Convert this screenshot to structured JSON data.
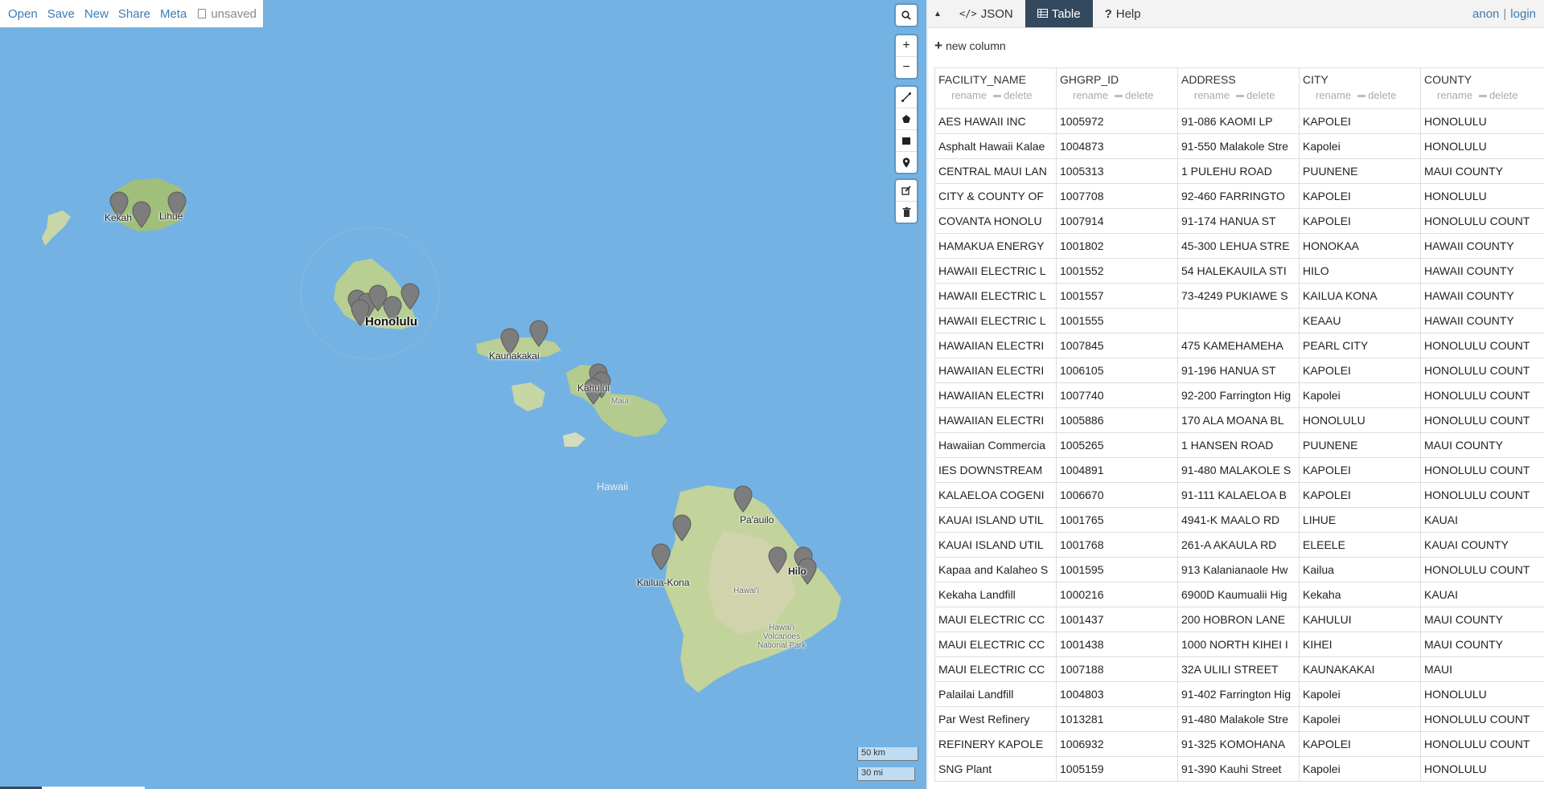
{
  "nav": {
    "open": "Open",
    "save": "Save",
    "new": "New",
    "share": "Share",
    "meta": "Meta",
    "unsaved": "unsaved"
  },
  "map": {
    "labels": {
      "kekaha": "Kekah",
      "lihue": "Lihue",
      "honolulu": "Honolulu",
      "kaunakakai": "Kaunakakai",
      "kahului": "Kahului",
      "maui": "Maui",
      "hawaii_sea": "Hawaii",
      "paauilo": "Pa'auilo",
      "kailua_kona": "Kailua-Kona",
      "hawaii_island": "Hawai'i",
      "hilo": "Hilo",
      "volcanoes": "Hawai'i Volcanoes National Park"
    },
    "scale": {
      "km": "50 km",
      "mi": "30 mi"
    },
    "controls": [
      "search-icon",
      "zoom-in",
      "zoom-out",
      "draw-line",
      "draw-polygon",
      "draw-rectangle",
      "draw-marker",
      "edit",
      "delete"
    ]
  },
  "tabs": {
    "collapse": "▲",
    "json": "JSON",
    "table": "Table",
    "help": "Help",
    "active": "Table"
  },
  "auth": {
    "anon": "anon",
    "login": "login"
  },
  "new_column": "new column",
  "columns": [
    {
      "name": "FACILITY_NAME",
      "rename": "rename",
      "delete": "delete"
    },
    {
      "name": "GHGRP_ID",
      "rename": "rename",
      "delete": "delete"
    },
    {
      "name": "ADDRESS",
      "rename": "rename",
      "delete": "delete"
    },
    {
      "name": "CITY",
      "rename": "rename",
      "delete": "delete"
    },
    {
      "name": "COUNTY",
      "rename": "rename",
      "delete": "delete"
    }
  ],
  "rows": [
    [
      "AES HAWAII INC",
      "1005972",
      "91-086 KAOMI LP",
      "KAPOLEI",
      "HONOLULU"
    ],
    [
      "Asphalt Hawaii Kalae",
      "1004873",
      "91-550 Malakole Stre",
      "Kapolei",
      "HONOLULU"
    ],
    [
      "CENTRAL MAUI LAN",
      "1005313",
      "1 PULEHU ROAD",
      "PUUNENE",
      "MAUI COUNTY"
    ],
    [
      "CITY & COUNTY OF",
      "1007708",
      "92-460 FARRINGTO",
      "KAPOLEI",
      "HONOLULU"
    ],
    [
      "COVANTA HONOLU",
      "1007914",
      "91-174 HANUA ST",
      "KAPOLEI",
      "HONOLULU COUNT"
    ],
    [
      "HAMAKUA ENERGY",
      "1001802",
      "45-300 LEHUA STRE",
      "HONOKAA",
      "HAWAII COUNTY"
    ],
    [
      "HAWAII ELECTRIC L",
      "1001552",
      "54 HALEKAUILA STI",
      "HILO",
      "HAWAII COUNTY"
    ],
    [
      "HAWAII ELECTRIC L",
      "1001557",
      "73-4249 PUKIAWE S",
      "KAILUA KONA",
      "HAWAII COUNTY"
    ],
    [
      "HAWAII ELECTRIC L",
      "1001555",
      "",
      "KEAAU",
      "HAWAII COUNTY"
    ],
    [
      "HAWAIIAN ELECTRI",
      "1007845",
      "475 KAMEHAMEHA",
      "PEARL CITY",
      "HONOLULU COUNT"
    ],
    [
      "HAWAIIAN ELECTRI",
      "1006105",
      "91-196 HANUA ST",
      "KAPOLEI",
      "HONOLULU COUNT"
    ],
    [
      "HAWAIIAN ELECTRI",
      "1007740",
      "92-200 Farrington Hig",
      "Kapolei",
      "HONOLULU COUNT"
    ],
    [
      "HAWAIIAN ELECTRI",
      "1005886",
      "170 ALA MOANA BL",
      "HONOLULU",
      "HONOLULU COUNT"
    ],
    [
      "Hawaiian Commercia",
      "1005265",
      "1 HANSEN ROAD",
      "PUUNENE",
      "MAUI COUNTY"
    ],
    [
      "IES DOWNSTREAM",
      "1004891",
      "91-480 MALAKOLE S",
      "KAPOLEI",
      "HONOLULU COUNT"
    ],
    [
      "KALAELOA COGENI",
      "1006670",
      "91-111 KALAELOA B",
      "KAPOLEI",
      "HONOLULU COUNT"
    ],
    [
      "KAUAI ISLAND UTIL",
      "1001765",
      "4941-K MAALO RD",
      "LIHUE",
      "KAUAI"
    ],
    [
      "KAUAI ISLAND UTIL",
      "1001768",
      "261-A AKAULA RD",
      "ELEELE",
      "KAUAI COUNTY"
    ],
    [
      "Kapaa and Kalaheo S",
      "1001595",
      "913 Kalanianaole Hw",
      "Kailua",
      "HONOLULU COUNT"
    ],
    [
      "Kekaha Landfill",
      "1000216",
      "6900D Kaumualii Hig",
      "Kekaha",
      "KAUAI"
    ],
    [
      "MAUI ELECTRIC CC",
      "1001437",
      "200 HOBRON LANE",
      "KAHULUI",
      "MAUI COUNTY"
    ],
    [
      "MAUI ELECTRIC CC",
      "1001438",
      "1000 NORTH KIHEI I",
      "KIHEI",
      "MAUI COUNTY"
    ],
    [
      "MAUI ELECTRIC CC",
      "1007188",
      "32A ULILI STREET",
      "KAUNAKAKAI",
      "MAUI"
    ],
    [
      "Palailai Landfill",
      "1004803",
      "91-402 Farrington Hig",
      "Kapolei",
      "HONOLULU"
    ],
    [
      "Par West Refinery",
      "1013281",
      "91-480 Malakole Stre",
      "Kapolei",
      "HONOLULU COUNT"
    ],
    [
      "REFINERY KAPOLE",
      "1006932",
      "91-325 KOMOHANA",
      "KAPOLEI",
      "HONOLULU COUNT"
    ],
    [
      "SNG Plant",
      "1005159",
      "91-390 Kauhi Street",
      "Kapolei",
      "HONOLULU"
    ]
  ]
}
